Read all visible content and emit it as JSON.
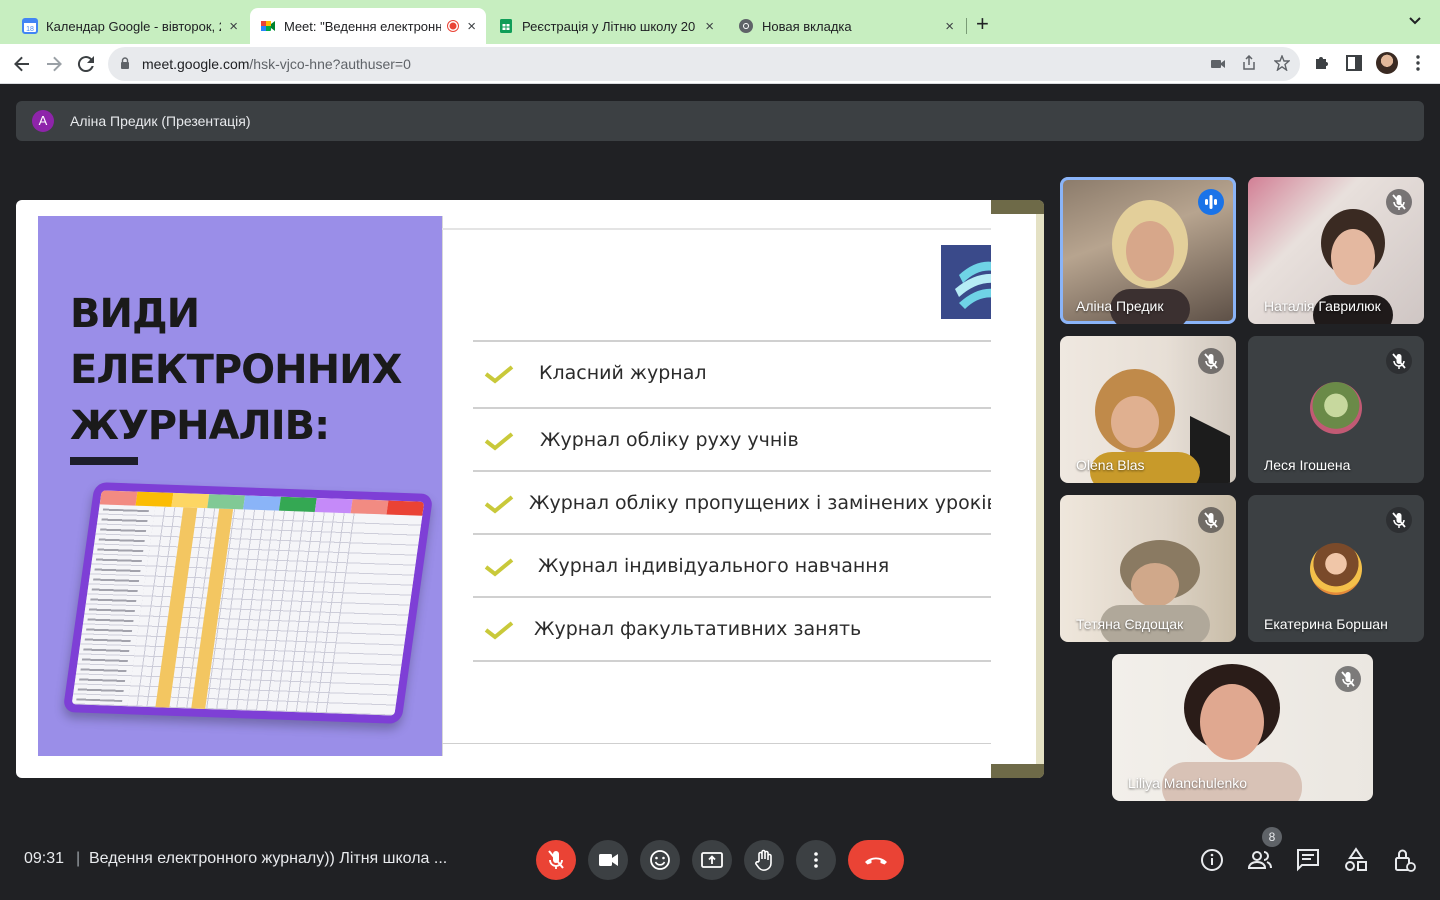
{
  "browser": {
    "tabs": [
      {
        "title": "Календар Google - вівторок, 2",
        "close": "×"
      },
      {
        "title": "Meet: \"Ведення електронн",
        "close": "×"
      },
      {
        "title": "Реєстрація у Літню школу 20",
        "close": "×"
      },
      {
        "title": "Новая вкладка",
        "close": "×"
      }
    ],
    "new_tab_label": "+",
    "url_host": "meet.google.com",
    "url_path": "/hsk-vjco-hne?authuser=0"
  },
  "meet": {
    "presenter": {
      "initial": "A",
      "label": "Аліна Предик (Презентація)"
    },
    "slide": {
      "heading": [
        "ВИДИ",
        "ЕЛЕКТРОННИХ",
        "ЖУРНАЛІВ:"
      ],
      "items": [
        "Класний журнал",
        "Журнал обліку руху учнів",
        "Журнал обліку пропущених і замінених уроків",
        "Журнал індивідуального навчання",
        "Журнал факультативних занять"
      ]
    },
    "participants": [
      {
        "name": "Аліна Предик",
        "state": "speaking"
      },
      {
        "name": "Наталія Гаврилюк",
        "state": "muted"
      },
      {
        "name": "Olena Blas",
        "state": "muted"
      },
      {
        "name": "Леся Ігошена",
        "state": "muted"
      },
      {
        "name": "Тетяна Євдощак",
        "state": "muted"
      },
      {
        "name": "Екатерина Боршан",
        "state": "muted"
      },
      {
        "name": "Liliya Manchulenko",
        "state": "muted"
      }
    ],
    "bottom": {
      "time": "09:31",
      "separator": "|",
      "title": "Ведення електронного журналу)) Літня школа ...",
      "participant_count": "8"
    }
  },
  "colors": {
    "tabbar_bg": "#c7eec0",
    "meet_bg": "#202124",
    "danger": "#ea4335",
    "accent": "#1a73e8",
    "slide_panel": "#9a8ee8",
    "check": "#c9c93a"
  }
}
